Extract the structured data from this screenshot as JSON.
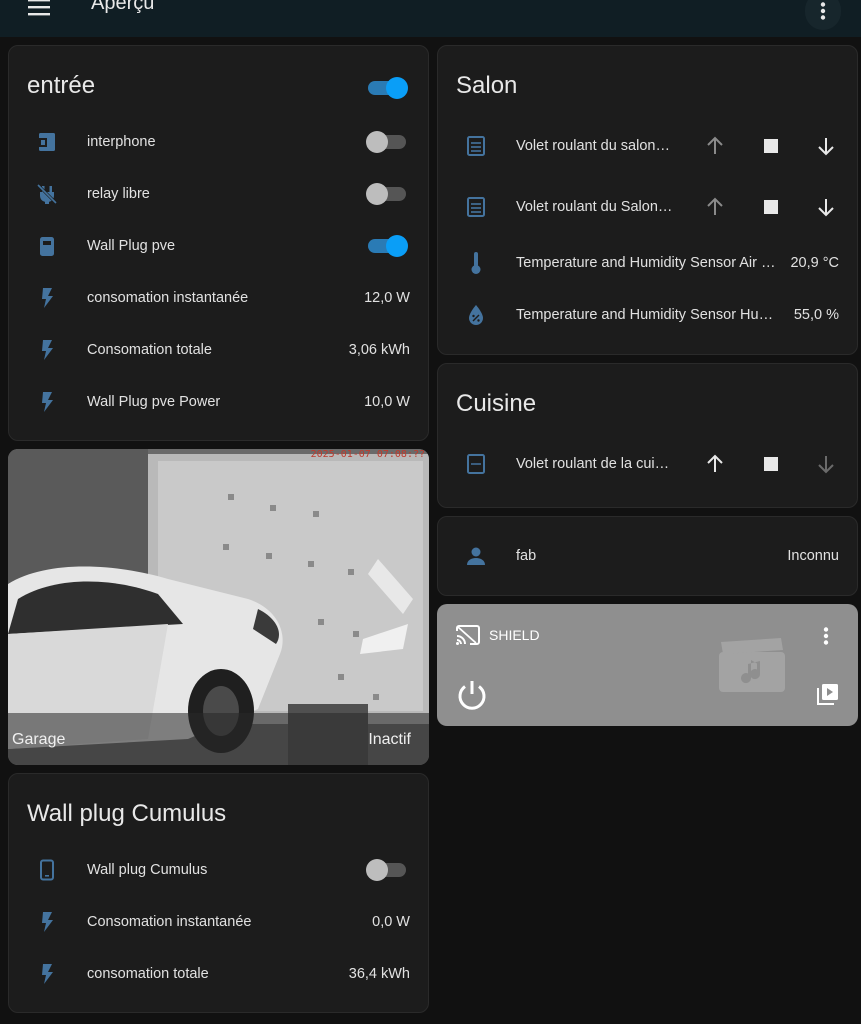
{
  "header": {
    "title": "Aperçu",
    "menu_icon": "menu-icon",
    "more_icon": "more-vertical-icon"
  },
  "entree": {
    "title": "entrée",
    "main_toggle_on": true,
    "rows": [
      {
        "icon": "door-intercom-icon",
        "label": "interphone",
        "type": "toggle",
        "on": false
      },
      {
        "icon": "power-plug-off-icon",
        "label": "relay libre",
        "type": "toggle",
        "on": false
      },
      {
        "icon": "socket-icon",
        "label": "Wall Plug pve",
        "type": "toggle",
        "on": true
      },
      {
        "icon": "flash-icon",
        "label": "consomation instantanée",
        "value": "12,0 W"
      },
      {
        "icon": "flash-icon",
        "label": "Consomation totale",
        "value": "3,06 kWh"
      },
      {
        "icon": "flash-icon",
        "label": "Wall Plug pve Power",
        "value": "10,0 W"
      }
    ]
  },
  "camera": {
    "name": "Garage",
    "state": "Inactif",
    "timestamp": "2025-01-07 07:08:??"
  },
  "cumulus": {
    "title": "Wall plug Cumulus",
    "rows": [
      {
        "icon": "cellphone-icon",
        "label": "Wall plug Cumulus",
        "type": "toggle",
        "on": false
      },
      {
        "icon": "flash-icon",
        "label": "Consomation instantanée",
        "value": "0,0 W"
      },
      {
        "icon": "flash-icon",
        "label": "consomation totale",
        "value": "36,4 kWh"
      }
    ]
  },
  "salon": {
    "title": "Salon",
    "rows": [
      {
        "icon": "window-shutter-icon",
        "label": "Volet roulant du salon…",
        "type": "cover"
      },
      {
        "icon": "window-shutter-icon",
        "label": "Volet roulant du Salon…",
        "type": "cover"
      },
      {
        "icon": "thermometer-icon",
        "label": "Temperature and Humidity Sensor Air …",
        "value": "20,9 °C"
      },
      {
        "icon": "water-percent-icon",
        "label": "Temperature and Humidity Sensor Hu…",
        "value": "55,0 %"
      }
    ]
  },
  "cuisine": {
    "title": "Cuisine",
    "rows": [
      {
        "icon": "window-shutter-icon",
        "label": "Volet roulant de la cui…",
        "type": "cover"
      }
    ]
  },
  "person": {
    "icon": "account-icon",
    "label": "fab",
    "value": "Inconnu"
  },
  "media": {
    "name": "SHIELD",
    "icons": [
      "cast-icon",
      "more-vertical-icon",
      "power-icon",
      "media-browse-icon"
    ]
  },
  "colors": {
    "accent": "#0a9ef7",
    "icon": "#44739e",
    "card": "#1c1c1c",
    "background": "#111111"
  }
}
